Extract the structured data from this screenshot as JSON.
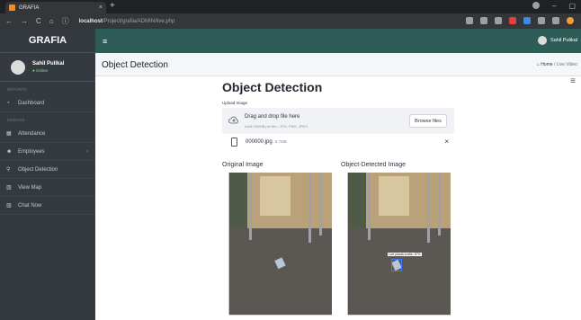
{
  "browser": {
    "tab_title": "GRAFIA",
    "tab_close": "×",
    "new_tab": "+",
    "url_host": "localhost",
    "url_path": "/Project/grafia/ADMIN/live.php",
    "nav_back": "←",
    "nav_forward": "→",
    "nav_reload": "C",
    "nav_home": "⌂",
    "nav_info": "ⓘ",
    "win_min": "–",
    "win_max": "▢",
    "win_close": "✕"
  },
  "sidebar": {
    "brand": "GRAFIA",
    "user": {
      "name": "Sahil Pulikal",
      "status": "● Online"
    },
    "section_reports": "REPORTS",
    "section_manage": "MANAGE",
    "items": [
      {
        "icon": "dashboard-icon",
        "glyph": "◔",
        "label": "Dashboard"
      },
      {
        "icon": "calendar-icon",
        "glyph": "▦",
        "label": "Attendance"
      },
      {
        "icon": "users-icon",
        "glyph": "☻",
        "label": "Employees",
        "chevron": "‹"
      },
      {
        "icon": "map-pin-icon",
        "glyph": "⚲",
        "label": "Object Detection"
      },
      {
        "icon": "chart-icon",
        "glyph": "▥",
        "label": "View Map"
      },
      {
        "icon": "chart-icon",
        "glyph": "▥",
        "label": "Chat Now"
      }
    ]
  },
  "topnav": {
    "menu_glyph": "≡",
    "user_name": "Sahil Pulikal"
  },
  "header": {
    "page_title": "Object Detection",
    "breadcrumb_home": "Home",
    "breadcrumb_sep": "/",
    "breadcrumb_current": "Live Video"
  },
  "main": {
    "title": "Object Detection",
    "menu_glyph": "≡",
    "upload_label": "Upload Image",
    "dropzone_text": "Drag and drop file here",
    "dropzone_limit": "Limit 200MB per file • JPG, PNG, JPEG",
    "browse_button": "Browse files",
    "file_name": "000000.jpg",
    "file_size": "5.7MB",
    "file_remove": "×",
    "original_caption": "Original Image",
    "detected_caption": "Object-Detected Image",
    "detection_label": "Live plastic bottle: 87%"
  },
  "colors": {
    "sidebar_bg": "#343a40",
    "topnav_bg": "#2e5c57",
    "detection_box": "#3a7cff"
  }
}
